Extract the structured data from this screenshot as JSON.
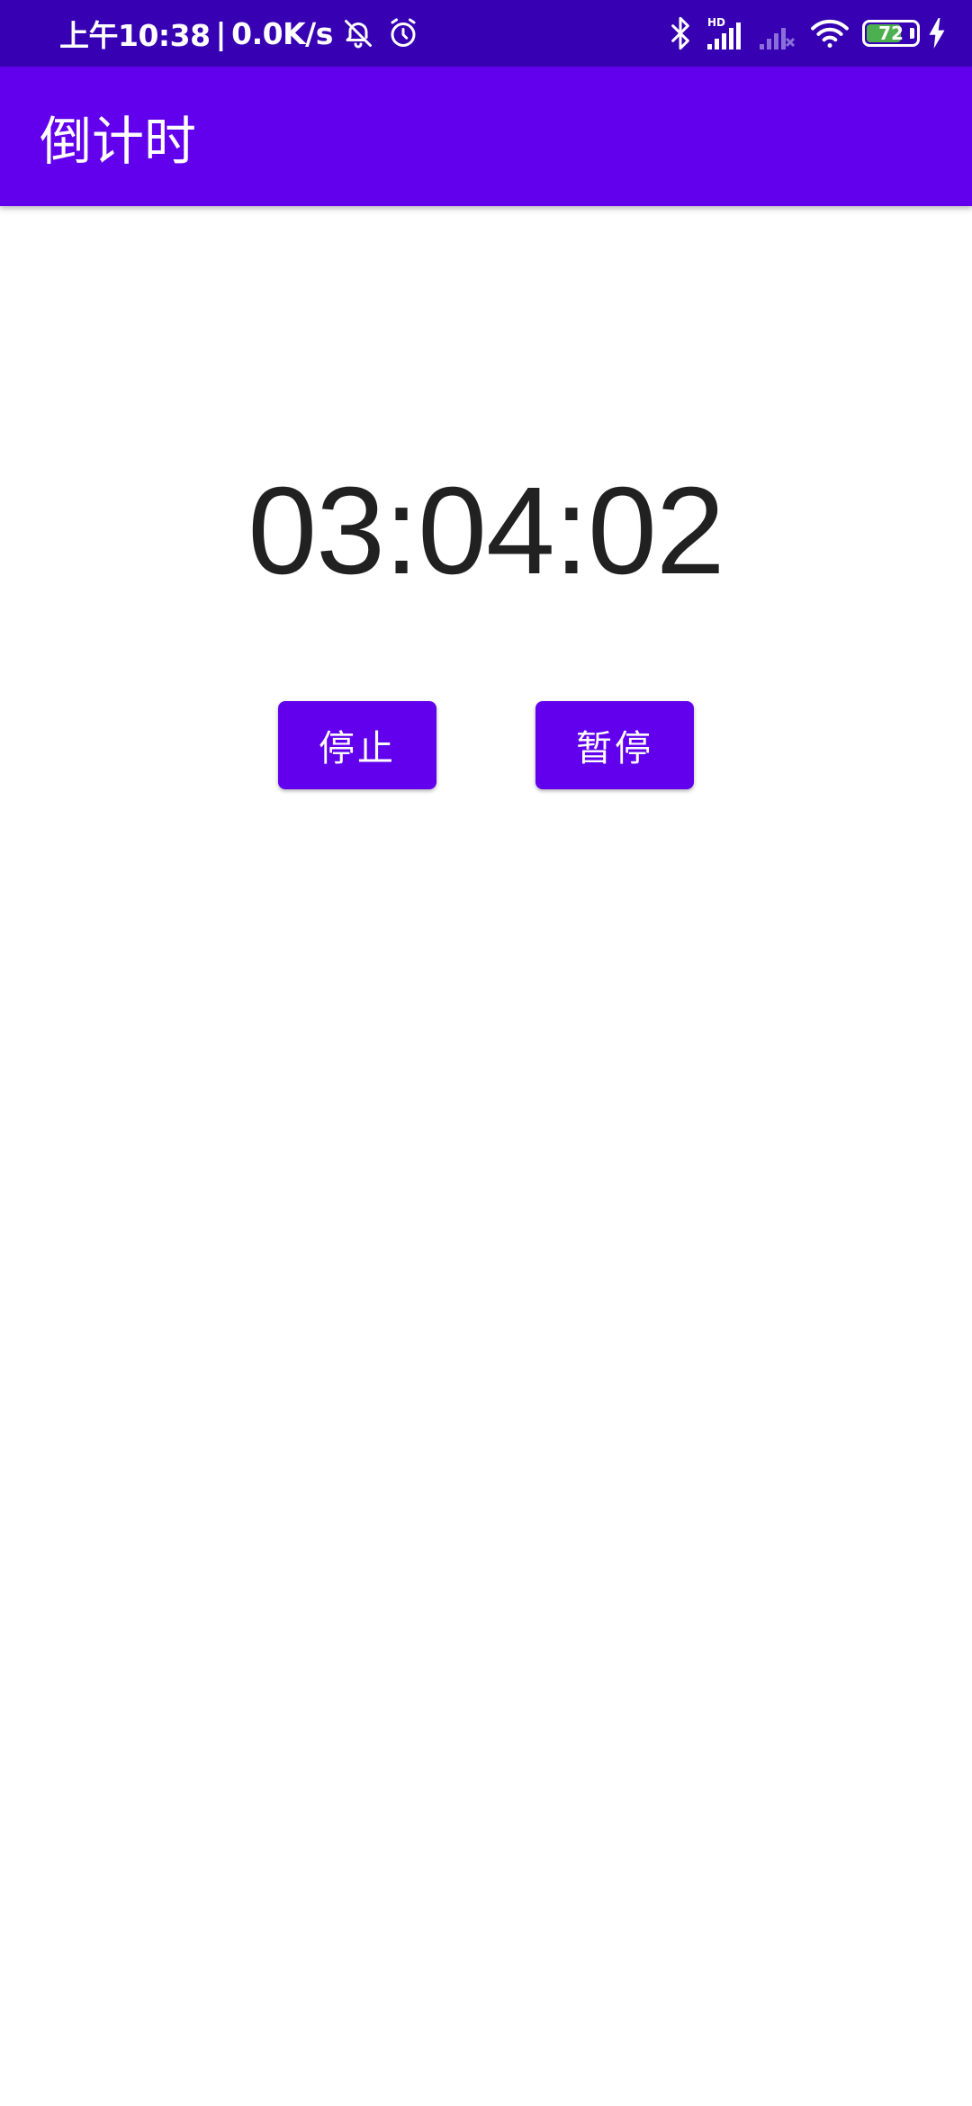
{
  "status_bar": {
    "time": "上午10:38",
    "separator": "|",
    "network_speed": "0.0K/s",
    "left_icons": [
      "bell-off-icon",
      "alarm-icon"
    ],
    "right_icons": [
      "bluetooth-icon",
      "signal-hd-icon",
      "signal-no-service-icon",
      "wifi-icon",
      "battery-icon",
      "charging-icon"
    ],
    "signal_label": "HD",
    "battery_level": "72",
    "battery_fraction": 0.72,
    "background_color": "#3700b3",
    "battery_color": "#4caf50"
  },
  "app_bar": {
    "title": "倒计时",
    "background_color": "#6200ee"
  },
  "timer": {
    "display": "03:04:02"
  },
  "buttons": {
    "stop_label": "停止",
    "pause_label": "暂停",
    "color": "#6200ee"
  }
}
